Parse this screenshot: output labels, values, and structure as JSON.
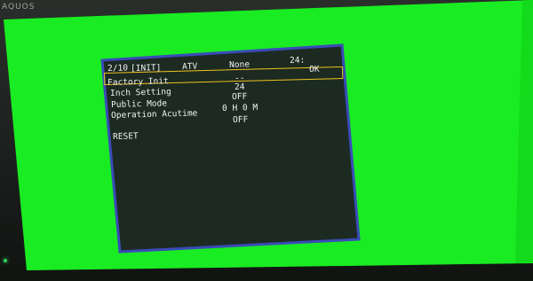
{
  "device": {
    "brand": "AQUOS",
    "screen_color": "#19ec22",
    "menu_bg": "#1c2a22",
    "menu_border": "#3a4bb8",
    "highlight_color": "#f0c21e"
  },
  "menu": {
    "page": "2/10",
    "section": "[INIT]",
    "source": "ATV",
    "mode": "None",
    "clock": "24:",
    "ok_label": "OK",
    "items": [
      {
        "label": "Factory Init",
        "value": "--"
      },
      {
        "label": "Inch Setting",
        "value": "24"
      },
      {
        "label": "Public Mode",
        "value": "OFF"
      },
      {
        "label": "Operation Acutime",
        "value": "0 H  0 M"
      },
      {
        "label": "RESET",
        "value": "OFF"
      }
    ]
  }
}
